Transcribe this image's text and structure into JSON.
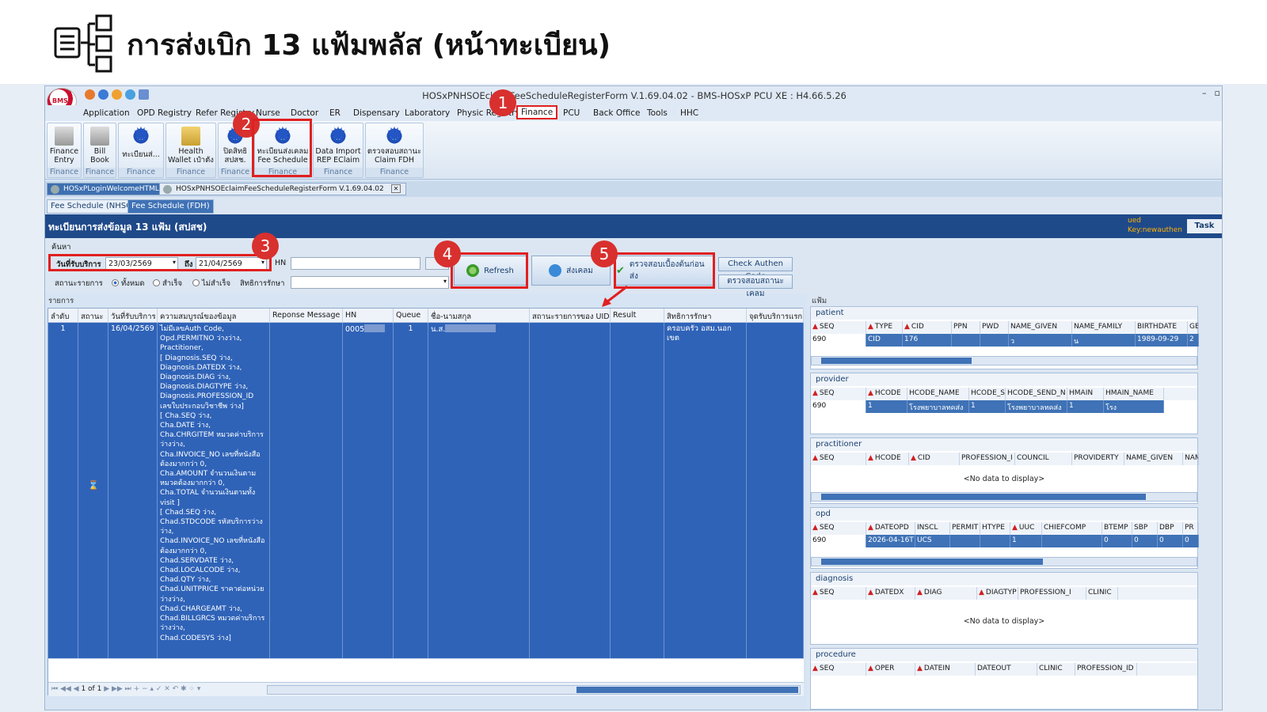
{
  "slide": {
    "title": "การส่งเบิก 13 แฟ้มพลัส (หน้าทะเบียน)"
  },
  "window": {
    "title": "HOSxPNHSOEclaimFeeScheduleRegisterForm V.1.69.04.02 - BMS-HOSxP PCU XE : H4.66.5.26",
    "min": "–",
    "max": "▫"
  },
  "logo_text": "BMS",
  "menu": [
    "Application",
    "OPD Registry",
    "Refer Registry",
    "Nurse",
    "Doctor",
    "ER",
    "Dispensary",
    "Laboratory",
    "Physic Registry",
    "Finance",
    "PCU",
    "Back Office",
    "Tools",
    "HHC"
  ],
  "ribbon": [
    {
      "label": "Finance\nEntry",
      "group": "Finance"
    },
    {
      "label": "Bill\nBook",
      "group": "Finance"
    },
    {
      "label": "ทะเบียนส่...",
      "group": "Finance"
    },
    {
      "label": "Health\nWallet เป๋าตัง",
      "group": "Finance"
    },
    {
      "label": "ปิดสิทธิ\nสปสช.",
      "group": "Finance"
    },
    {
      "label": "ทะเบียนส่งเคลม\nFee Schedule",
      "group": "Finance"
    },
    {
      "label": "Data Import\nREP EClaim",
      "group": "Finance"
    },
    {
      "label": "ตรวจสอบสถานะ\nClaim FDH",
      "group": "Finance"
    }
  ],
  "doc_tabs": [
    "HOSxPLoginWelcomeHTMLForm",
    "HOSxPNHSOEclaimFeeScheduleRegisterForm V.1.69.04.02"
  ],
  "doc_tab_close": "✕",
  "sub_tabs": [
    "Fee Schedule (NHSO)",
    "Fee Schedule (FDH)"
  ],
  "form": {
    "title": "ทะเบียนการส่งข้อมูล 13 แฟ้ม (สปสช)",
    "user_line1": "ued",
    "user_line2": "Key:newauthen",
    "task": "Task"
  },
  "search": {
    "group_label": "ค้นหา",
    "date_label": "วันที่รับบริการ",
    "date_from": "23/03/2569",
    "to_label": "ถึง",
    "date_to": "21/04/2569",
    "hn_label": "HN",
    "status_label": "สถานะรายการ",
    "radio_all": "ทั้งหมด",
    "radio_success": "สำเร็จ",
    "radio_fail": "ไม่สำเร็จ",
    "right_label": "สิทธิการรักษา"
  },
  "buttons": {
    "refresh": "Refresh",
    "send_claim": "ส่งเคลม",
    "precheck": "ตรวจสอบเบื้องต้นก่อนส่ง",
    "check_authen": "Check Authen Code",
    "check_claim": "ตรวจสอบสถานะเคลม"
  },
  "badges": [
    "1",
    "2",
    "3",
    "4",
    "5"
  ],
  "list": {
    "label": "รายการ",
    "columns": [
      "ลำดับ",
      "สถานะ",
      "วันที่รับบริการ",
      "ความสมบูรณ์ของข้อมูล",
      "Reponse Message",
      "HN",
      "Queue",
      "ชื่อ-นามสกุล",
      "สถานะรายการของ UID",
      "Result",
      "สิทธิการรักษา",
      "จุดรับบริการแรก"
    ],
    "row": {
      "no": "1",
      "status_icon": "⌛",
      "date": "16/04/2569",
      "completeness": "ไม่มีเลขAuth Code,\nOpd.PERMITNO ว่างว่าง,\nPractitioner,\n[ Diagnosis.SEQ ว่าง,\nDiagnosis.DATEDX ว่าง,\nDiagnosis.DIAG ว่าง,\nDiagnosis.DIAGTYPE ว่าง,\nDiagnosis.PROFESSION_ID เลขใบประกอบวิชาชีพ ว่าง]\n[ Cha.SEQ ว่าง,\nCha.DATE ว่าง,\nCha.CHRGITEM หมวดค่าบริการว่างว่าง,\nCha.INVOICE_NO เลขที่หนังสือต้องมากกว่า 0,\nCha.AMOUNT จำนวนเงินตามหมวดต้องมากกว่า 0,\nCha.TOTAL จำนวนเงินตามทั้ง visit ]\n[ Chad.SEQ ว่าง,\nChad.STDCODE รหัสบริการว่างว่าง,\nChad.INVOICE_NO เลขที่หนังสือต้องมากกว่า 0,\nChad.SERVDATE ว่าง,\nChad.LOCALCODE ว่าง,\nChad.QTY ว่าง,\nChad.UNITPRICE ราคาต่อหน่วยว่างว่าง,\nChad.CHARGEAMT ว่าง,\nChad.BILLGRCS หมวดค่าบริการว่างว่าง,\nChad.CODESYS ว่าง]",
      "hn": "0005",
      "queue": "1",
      "name": "น.ส.",
      "right": "ครอบครัว อสม.นอกเขต"
    },
    "pager": "1 of 1"
  },
  "right_panel": {
    "title": "แฟ้ม",
    "nodata": "<No data to display>",
    "patient": {
      "name": "patient",
      "cols": [
        "SEQ",
        "TYPE",
        "CID",
        "PPN",
        "PWD",
        "NAME_GIVEN",
        "NAME_FAMILY",
        "BIRTHDATE",
        "GE"
      ],
      "row": [
        "690",
        "CID",
        "176",
        "",
        "",
        "ว",
        "น",
        "1989-09-29",
        "2"
      ]
    },
    "provider": {
      "name": "provider",
      "cols": [
        "SEQ",
        "HCODE",
        "HCODE_NAME",
        "HCODE_S",
        "HCODE_SEND_N",
        "HMAIN",
        "HMAIN_NAME"
      ],
      "row": [
        "690",
        "1",
        "โรงพยาบาลทคส่ง",
        "1",
        "โรงพยาบาลทคส่ง",
        "1",
        "โรง"
      ]
    },
    "practitioner": {
      "name": "practitioner",
      "cols": [
        "SEQ",
        "HCODE",
        "CID",
        "PROFESSION_I",
        "COUNCIL",
        "PROVIDERTY",
        "NAME_GIVEN",
        "NAM"
      ]
    },
    "opd": {
      "name": "opd",
      "cols": [
        "SEQ",
        "DATEOPD",
        "INSCL",
        "PERMIT",
        "HTYPE",
        "UUC",
        "CHIEFCOMP",
        "BTEMP",
        "SBP",
        "DBP",
        "PR"
      ],
      "row": [
        "690",
        "2026-04-16T",
        "UCS",
        "",
        "",
        "1",
        "",
        "0",
        "0",
        "0",
        "0"
      ]
    },
    "diagnosis": {
      "name": "diagnosis",
      "cols": [
        "SEQ",
        "DATEDX",
        "DIAG",
        "DIAGTYP",
        "PROFESSION_I",
        "CLINIC"
      ]
    },
    "procedure": {
      "name": "procedure",
      "cols": [
        "SEQ",
        "OPER",
        "DATEIN",
        "DATEOUT",
        "CLINIC",
        "PROFESSION_ID"
      ]
    }
  },
  "colors": {
    "header_blue": "#1f4a8a",
    "selection_blue": "#2f63b8",
    "highlight_red": "#e02020",
    "badge_red": "#d8302e"
  }
}
